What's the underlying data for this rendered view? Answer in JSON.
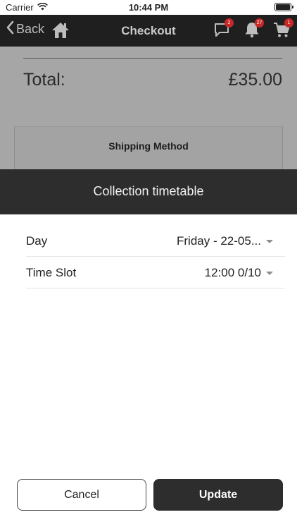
{
  "status_bar": {
    "carrier": "Carrier",
    "time": "10:44 PM"
  },
  "navbar": {
    "back_label": "Back",
    "title": "Checkout",
    "icons": [
      "chat-icon",
      "bell-icon",
      "cart-icon"
    ],
    "chat_badge": "2",
    "notifications_badge": "27",
    "cart_badge": "1"
  },
  "background_page": {
    "total_label": "Total:",
    "total_value": "£35.00",
    "shipping_method_label": "Shipping Method"
  },
  "modal": {
    "title": "Collection timetable",
    "fields": [
      {
        "label": "Day",
        "value": "Friday - 22-05..."
      },
      {
        "label": "Time Slot",
        "value": "12:00 0/10"
      }
    ],
    "cancel_label": "Cancel",
    "update_label": "Update"
  },
  "colors": {
    "navbar_bg": "#1f1f1f",
    "sheet_header_bg": "#2d2d2d",
    "badge": "#c62828",
    "dim_overlay": "#a6a6a6"
  }
}
